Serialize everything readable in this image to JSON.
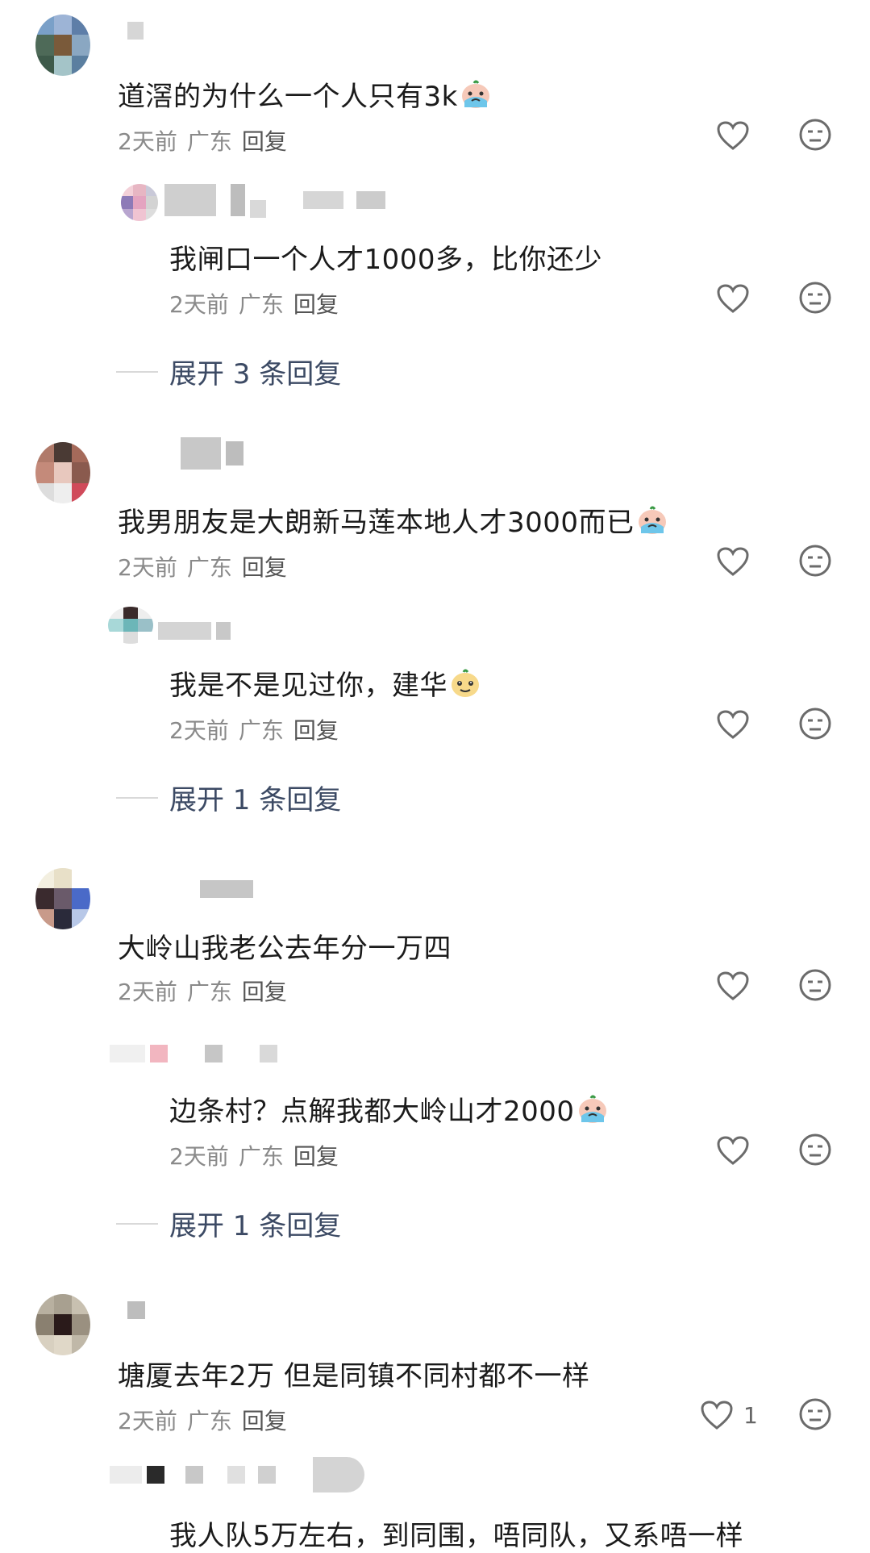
{
  "comments": [
    {
      "text": "道滘的为什么一个人只有3k",
      "emoji": "crying-emoji",
      "time": "2天前",
      "region": "广东",
      "reply_label": "回复",
      "reply": {
        "text": "我闸口一个人才1000多，比你还少",
        "time": "2天前",
        "region": "广东",
        "reply_label": "回复"
      },
      "expand": "展开 3 条回复"
    },
    {
      "text": "我男朋友是大朗新马莲本地人才3000而已",
      "emoji": "crying-emoji",
      "time": "2天前",
      "region": "广东",
      "reply_label": "回复",
      "reply": {
        "text": "我是不是见过你，建华",
        "emoji": "smug-emoji",
        "time": "2天前",
        "region": "广东",
        "reply_label": "回复"
      },
      "expand": "展开 1 条回复"
    },
    {
      "text": "大岭山我老公去年分一万四",
      "time": "2天前",
      "region": "广东",
      "reply_label": "回复",
      "reply": {
        "text": "边条村？点解我都大岭山才2000",
        "emoji": "crying-emoji",
        "time": "2天前",
        "region": "广东",
        "reply_label": "回复"
      },
      "expand": "展开 1 条回复"
    },
    {
      "text": "塘厦去年2万 但是同镇不同村都不一样",
      "time": "2天前",
      "region": "广东",
      "reply_label": "回复",
      "like_count": "1",
      "reply": {
        "text": "我人队5万左右，到同围，唔同队，又系唔一样"
      }
    }
  ],
  "colors": {
    "text": "#1b1b1b",
    "meta": "#8a8a8a",
    "expand": "#3c4a64",
    "icon": "#6b6b6b"
  }
}
